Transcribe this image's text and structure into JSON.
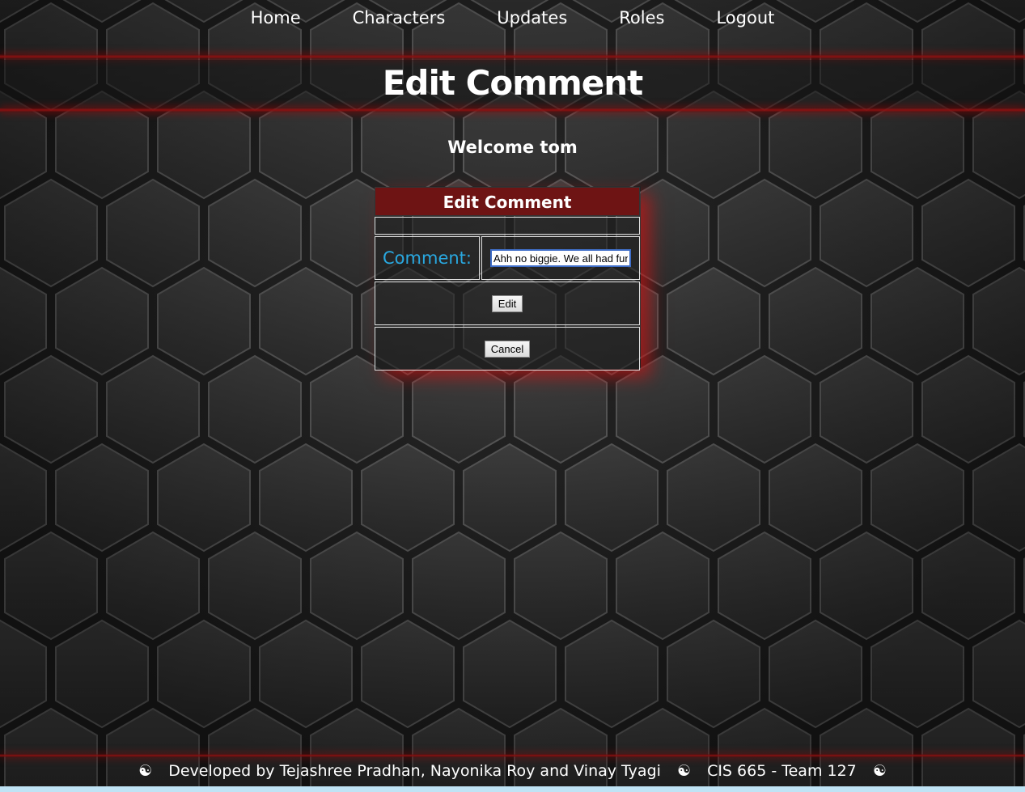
{
  "nav": {
    "items": [
      {
        "label": "Home"
      },
      {
        "label": "Characters"
      },
      {
        "label": "Updates"
      },
      {
        "label": "Roles"
      },
      {
        "label": "Logout"
      }
    ]
  },
  "page": {
    "title": "Edit Comment",
    "welcome": "Welcome tom"
  },
  "form": {
    "header": "Edit Comment",
    "comment_label": "Comment:",
    "comment_value": "Ahh no biggie. We all had fun",
    "edit_label": "Edit",
    "cancel_label": "Cancel"
  },
  "footer": {
    "symbol": "☯",
    "credits": "Developed by Tejashree Pradhan, Nayonika Roy and Vinay Tyagi",
    "course": "CIS 665 - Team 127"
  },
  "colors": {
    "accent_red": "#8b1010",
    "label_blue": "#29a8e0"
  }
}
